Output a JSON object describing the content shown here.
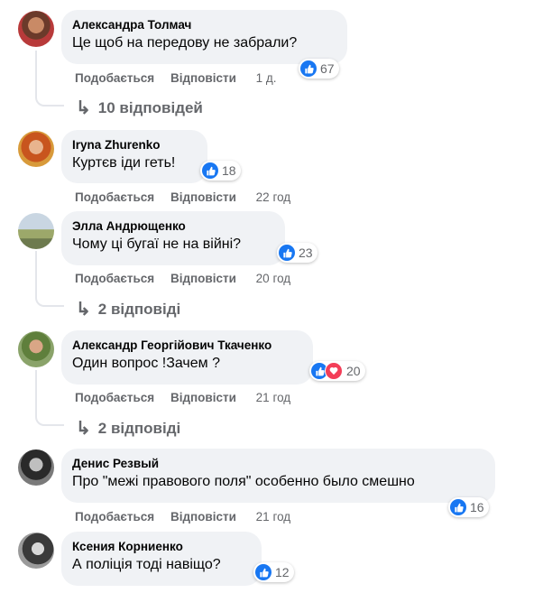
{
  "comments": [
    {
      "author": "Александра Толмач",
      "text": "Це щоб на передову не забрали?",
      "reactions": "67",
      "like": "Подобається",
      "reply": "Відповісти",
      "time": "1 д.",
      "replies": "10 відповідей"
    },
    {
      "author": "Iryna Zhurenko",
      "text": "Куртєв іди геть!",
      "reactions": "18",
      "like": "Подобається",
      "reply": "Відповісти",
      "time": "22 год"
    },
    {
      "author": "Элла Андрющенко",
      "text": "Чому ці бугаї не на війні?",
      "reactions": "23",
      "like": "Подобається",
      "reply": "Відповісти",
      "time": "20 год",
      "replies": "2 відповіді"
    },
    {
      "author": "Александр Георгійович Ткаченко",
      "text": "Один вопрос !Зачем ?",
      "reactions": "20",
      "like": "Подобається",
      "reply": "Відповісти",
      "time": "21 год",
      "replies": "2 відповіді"
    },
    {
      "author": "Денис Резвый",
      "text": "Про \"межі правового поля\" особенно было смешно",
      "reactions": "16",
      "like": "Подобається",
      "reply": "Відповісти",
      "time": "21 год"
    },
    {
      "author": "Ксения Корниенко",
      "text": "А поліція тоді навіщо?",
      "reactions": "12"
    }
  ],
  "icons": {
    "like": "thumbs-up-icon",
    "love": "heart-icon",
    "reply_arrow": "reply-arrow-icon"
  },
  "colors": {
    "like_blue": "#1877f2",
    "love_red": "#f33e58",
    "bubble": "#f0f2f5",
    "muted": "#65676b"
  }
}
